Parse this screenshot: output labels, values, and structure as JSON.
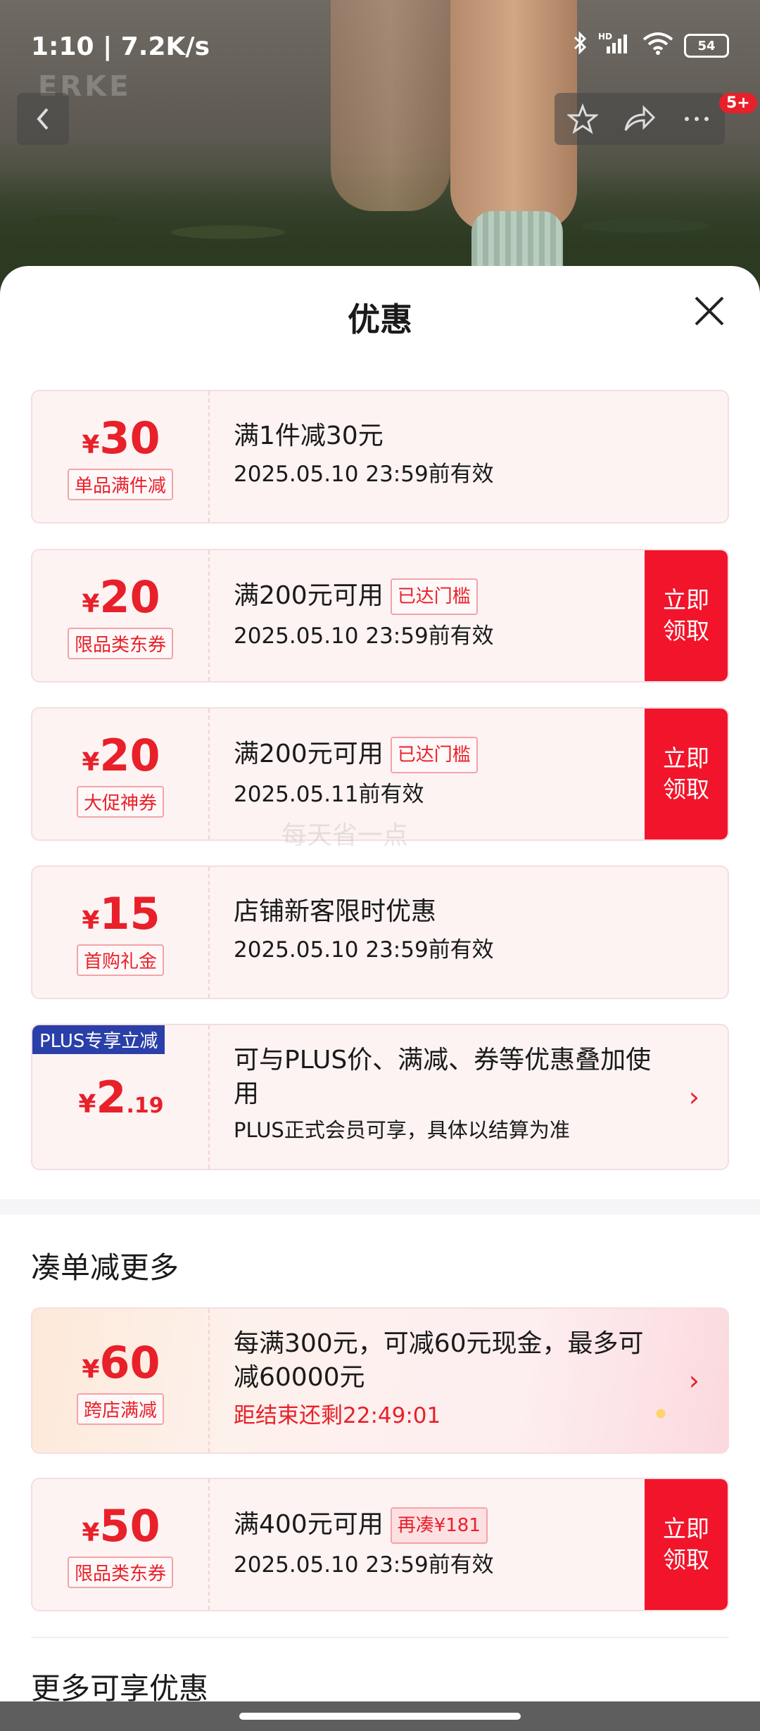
{
  "status_bar": {
    "time": "1:10 | 7.2K/s",
    "battery": "54",
    "hd": "HD"
  },
  "hero": {
    "logo": "ERKE"
  },
  "toolbar": {
    "cart_badge": "5+"
  },
  "sheet": {
    "title": "优惠"
  },
  "watermark": "每天省一点",
  "coupons": [
    {
      "yen": "¥",
      "amount": "30",
      "tag": "单品满件减",
      "title": "满1件减30元",
      "validity": "2025.05.10 23:59前有效"
    },
    {
      "yen": "¥",
      "amount": "20",
      "tag": "限品类东券",
      "title": "满200元可用",
      "pill": "已达门槛",
      "validity": "2025.05.10 23:59前有效",
      "claim": "立即\n领取"
    },
    {
      "yen": "¥",
      "amount": "20",
      "tag": "大促神券",
      "title": "满200元可用",
      "pill": "已达门槛",
      "validity": "2025.05.11前有效",
      "claim": "立即\n领取"
    },
    {
      "yen": "¥",
      "amount": "15",
      "tag": "首购礼金",
      "title": "店铺新客限时优惠",
      "validity": "2025.05.10 23:59前有效"
    },
    {
      "plus_tag": "PLUS专享立减",
      "yen": "¥",
      "amount": "2",
      "decimal": ".19",
      "title": "可与PLUS价、满减、券等优惠叠加使用",
      "validity": "PLUS正式会员可享，具体以结算为准",
      "arrow": "›"
    }
  ],
  "section_more": {
    "title": "凑单减更多"
  },
  "more_coupons": [
    {
      "yen": "¥",
      "amount": "60",
      "tag": "跨店满减",
      "title": "每满300元，可减60元现金，最多可减60000元",
      "countdown": "距结束还剩22:49:01",
      "arrow": "›"
    },
    {
      "yen": "¥",
      "amount": "50",
      "tag": "限品类东券",
      "title": "满400元可用",
      "pill": "再凑¥181",
      "validity": "2025.05.10 23:59前有效",
      "claim": "立即\n领取"
    }
  ],
  "section_extra": {
    "title": "更多可享优惠"
  },
  "colors": {
    "accent_red": "#e8202a",
    "claim_red": "#f2142a",
    "plus_blue": "#2a3fa8"
  }
}
